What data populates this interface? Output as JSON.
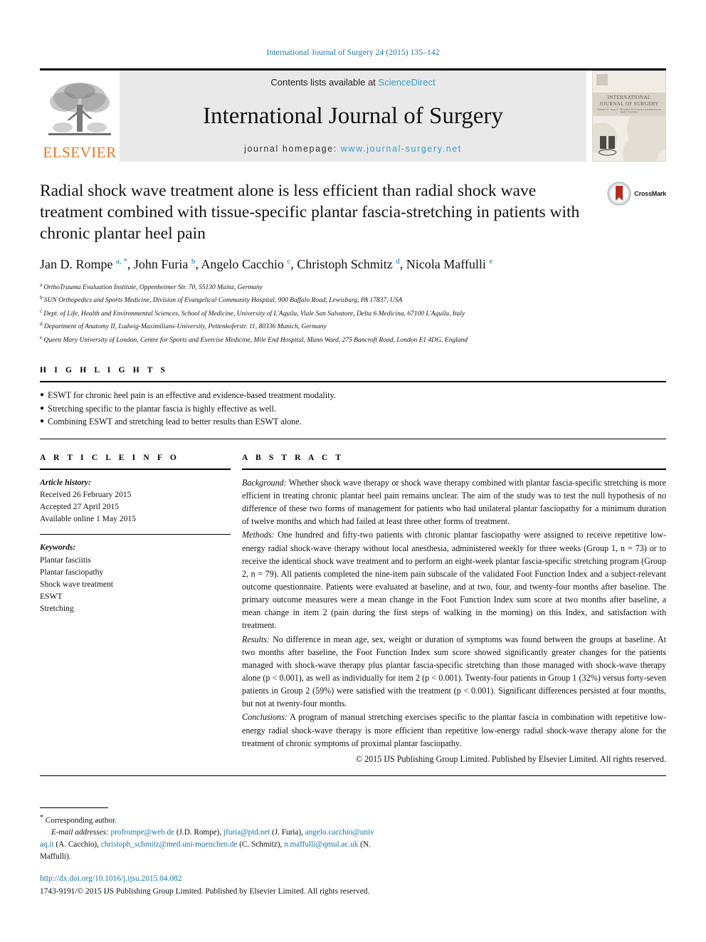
{
  "running_head": "International Journal of Surgery 24 (2015) 135–142",
  "banner": {
    "publisher_logo_label": "ELSEVIER",
    "contents_prefix": "Contents lists available at ",
    "contents_link": "ScienceDirect",
    "journal_title": "International Journal of Surgery",
    "homepage_prefix": "journal homepage: ",
    "homepage_url": "www.journal-surgery.net",
    "cover": {
      "line1": "INTERNATIONAL",
      "line2": "JOURNAL OF SURGERY",
      "sub": "Volume 24 · Issue 4 · December 2015\nwww.sciencedirect.com  ISSN 1743-9191"
    },
    "link_color": "#3a9bc9"
  },
  "article": {
    "title": "Radial shock wave treatment alone is less efficient than radial shock wave treatment combined with tissue-specific plantar fascia-stretching in patients with chronic plantar heel pain",
    "crossmark_label": "CrossMark",
    "authors": [
      {
        "name": "Jan D. Rompe",
        "marks": "a, *"
      },
      {
        "name": "John Furia",
        "marks": "b"
      },
      {
        "name": "Angelo Cacchio",
        "marks": "c"
      },
      {
        "name": "Christoph Schmitz",
        "marks": "d"
      },
      {
        "name": "Nicola Maffulli",
        "marks": "e"
      }
    ],
    "affiliations": [
      {
        "mark": "a",
        "text": "OrthoTrauma Evaluation Institute, Oppenheimer Str. 70, 55130 Mainz, Germany"
      },
      {
        "mark": "b",
        "text": "SUN Orthopedics and Sports Medicine, Division of Evangelical Community Hospital, 900 Buffalo Road, Lewisburg, PA 17837, USA"
      },
      {
        "mark": "c",
        "text": "Dept. of Life, Health and Environmental Sciences, School of Medicine, University of L'Aquila, Viale San Salvatore, Delta 6 Medicina, 67100 L'Aquila, Italy"
      },
      {
        "mark": "d",
        "text": "Department of Anatomy II, Ludwig-Maximilians-University, Pettenkoferstr. 11, 80336 Munich, Germany"
      },
      {
        "mark": "e",
        "text": "Queen Mary University of London, Centre for Sports and Exercise Medicine, Mile End Hospital, Mann Ward, 275 Bancroft Road, London E1 4DG, England"
      }
    ]
  },
  "highlights": {
    "heading": "H I G H L I G H T S",
    "items": [
      "ESWT for chronic heel pain is an effective and evidence-based treatment modality.",
      "Stretching specific to the plantar fascia is highly effective as well.",
      "Combining ESWT and stretching lead to better results than ESWT alone."
    ]
  },
  "article_info": {
    "heading": "A R T I C L E   I N F O",
    "history_label": "Article history:",
    "history": [
      "Received 26 February 2015",
      "Accepted 27 April 2015",
      "Available online 1 May 2015"
    ],
    "keywords_label": "Keywords:",
    "keywords": [
      "Plantar fasciitis",
      "Plantar fasciopathy",
      "Shock wave treatment",
      "ESWT",
      "Stretching"
    ]
  },
  "abstract": {
    "heading": "A B S T R A C T",
    "sections": [
      {
        "lead": "Background:",
        "text": " Whether shock wave therapy or shock wave therapy combined with plantar fascia-specific stretching is more efficient in treating chronic plantar heel pain remains unclear. The aim of the study was to test the null hypothesis of no difference of these two forms of management for patients who had unilateral plantar fasciopathy for a minimum duration of twelve months and which had failed at least three other forms of treatment."
      },
      {
        "lead": "Methods:",
        "text": " One hundred and fifty-two patients with chronic plantar fasciopathy were assigned to receive repetitive low-energy radial shock-wave therapy without local anesthesia, administered weekly for three weeks (Group 1, n = 73) or to receive the identical shock wave treatment and to perform an eight-week plantar fascia-specific stretching program (Group 2, n = 79). All patients completed the nine-item pain subscale of the validated Foot Function Index and a subject-relevant outcome questionnaire. Patients were evaluated at baseline, and at two, four, and twenty-four months after baseline. The primary outcome measures were a mean change in the Foot Function Index sum score at two months after baseline, a mean change in item 2 (pain during the first steps of walking in the morning) on this Index, and satisfaction with treatment."
      },
      {
        "lead": "Results:",
        "text": " No difference in mean age, sex, weight or duration of symptoms was found between the groups at baseline. At two months after baseline, the Foot Function Index sum score showed significantly greater changes for the patients managed with shock-wave therapy plus plantar fascia-specific stretching than those managed with shock-wave therapy alone (p < 0.001), as well as individually for item 2 (p < 0.001). Twenty-four patients in Group 1 (32%) versus forty-seven patients in Group 2 (59%) were satisfied with the treatment (p < 0.001). Significant differences persisted at four months, but not at twenty-four months."
      },
      {
        "lead": "Conclusions:",
        "text": " A program of manual stretching exercises specific to the plantar fascia in combination with repetitive low-energy radial shock-wave therapy is more efficient than repetitive low-energy radial shock-wave therapy alone for the treatment of chronic symptoms of proximal plantar fasciopathy."
      }
    ],
    "copyright": "© 2015 IJS Publishing Group Limited. Published by Elsevier Limited. All rights reserved."
  },
  "footnotes": {
    "corresponding_author": "Corresponding author.",
    "email_label": "E-mail addresses:",
    "emails": [
      {
        "address": "profrompe@web.de",
        "person": "(J.D. Rompe)"
      },
      {
        "address": "jfuria@ptd.net",
        "person": "(J. Furia)"
      },
      {
        "address": "angelo.cacchio@univaq.it",
        "person": "(A. Cacchio)"
      },
      {
        "address": "christoph_schmitz@med.uni-muenchen.de",
        "person": "(C. Schmitz)"
      },
      {
        "address": "n.maffulli@qmul.ac.uk",
        "person": "(N. Maffulli)"
      }
    ],
    "doi": "http://dx.doi.org/10.1016/j.ijsu.2015.04.082",
    "issn_line": "1743-9191/© 2015 IJS Publishing Group Limited. Published by Elsevier Limited. All rights reserved."
  }
}
